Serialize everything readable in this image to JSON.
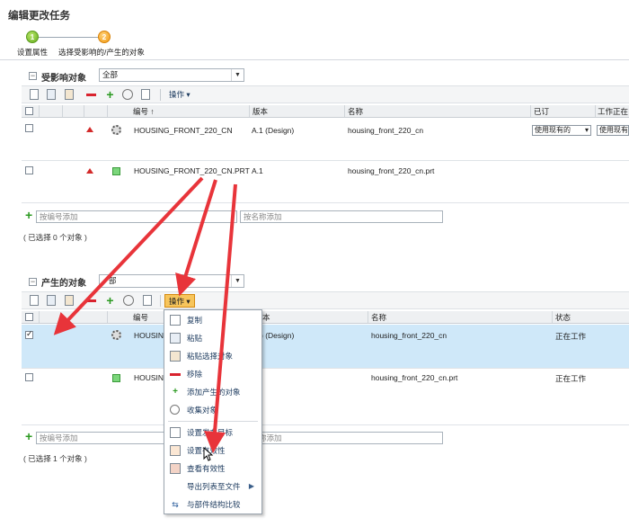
{
  "window": {
    "title": "编辑更改任务"
  },
  "wizard": {
    "steps": [
      {
        "num": "1",
        "label": "设置属性"
      },
      {
        "num": "2",
        "label": "选择受影响的/产生的对象"
      }
    ]
  },
  "affected": {
    "header": "受影响对象",
    "filter_value": "全部",
    "toolbar_operations": "操作",
    "columns": [
      "编号",
      "版本",
      "名称",
      "已订",
      "工作正在"
    ],
    "sort_indicator": "↑",
    "rows": [
      {
        "number": "HOUSING_FRONT_220_CN",
        "version": "A.1 (Design)",
        "name": "housing_front_220_cn",
        "subscribed": "使用现有的",
        "working": "使用现有"
      },
      {
        "number": "HOUSING_FRONT_220_CN.PRT",
        "version": "A.1",
        "name": "housing_front_220_cn.prt"
      }
    ],
    "add_by_number_placeholder": "按编号添加",
    "add_by_name_placeholder": "按名称添加",
    "selection_status": "( 已选择 0 个对象 )"
  },
  "resulting": {
    "header": "产生的对象",
    "filter_value": "部",
    "toolbar_operations": "操作",
    "columns": [
      "编号",
      "本",
      "名称",
      "状态"
    ],
    "rows": [
      {
        "number": "HOUSIN",
        "version": ") (Design)",
        "name": "housing_front_220_cn",
        "state": "正在工作",
        "checked": true
      },
      {
        "number": "HOUSIN",
        "version": "",
        "name": "housing_front_220_cn.prt",
        "state": "正在工作",
        "checked": false
      }
    ],
    "add_by_number_placeholder": "按编号添加",
    "add_by_name_placeholder": "按名称添加",
    "add_by_name_visible": "称添加",
    "selection_status": "( 已选择 1 个对象 )"
  },
  "context_menu": {
    "items": [
      {
        "label": "复制",
        "icon": "copy-icon"
      },
      {
        "label": "粘贴",
        "icon": "paste-icon"
      },
      {
        "label": "粘贴选择对象",
        "icon": "paste-selection-icon"
      },
      {
        "label": "移除",
        "icon": "remove-icon"
      },
      {
        "label": "添加产生的对象",
        "icon": "add-icon"
      },
      {
        "label": "收集对象",
        "icon": "collect-icon"
      },
      {
        "label": "设置发布目标",
        "icon": "publish-target-icon"
      },
      {
        "label": "设置有效性",
        "icon": "set-effectivity-icon"
      },
      {
        "label": "查看有效性",
        "icon": "view-effectivity-icon"
      },
      {
        "label": "导出列表至文件",
        "icon": "chevron-right-icon"
      },
      {
        "label": "与部件结构比较",
        "icon": "compare-icon"
      }
    ]
  },
  "colors": {
    "selected_row": "#cfe8f9",
    "annotation_arrow": "#e8343a",
    "operations_active": "#f7c55c"
  }
}
